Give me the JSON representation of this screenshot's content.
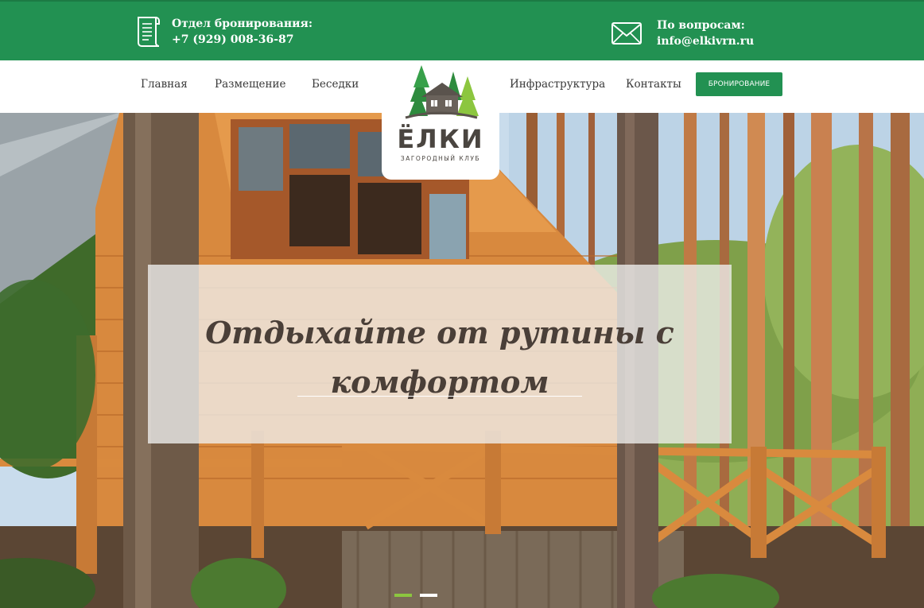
{
  "topbar": {
    "booking": {
      "label": "Отдел бронирования:",
      "value": "+7 (929) 008-36-87",
      "icon": "scroll-document-icon"
    },
    "questions": {
      "label": "По вопросам:",
      "value": "info@elkivrn.ru",
      "icon": "envelope-icon"
    },
    "color": "#229152"
  },
  "nav": {
    "items": [
      "Главная",
      "Размещение",
      "Беседки",
      "Инфраструктура",
      "Контакты"
    ],
    "cta": "бронирование"
  },
  "logo": {
    "word": "ЁЛКИ",
    "subtitle": "ЗАГОРОДНЫЙ КЛУБ"
  },
  "hero": {
    "headline_line1": "Отдыхайте от рутины с",
    "headline_line2": "комфортом"
  },
  "slider": {
    "slides": 2,
    "active": 1,
    "active_color": "#8cc63f",
    "inactive_color": "#ffffff"
  }
}
